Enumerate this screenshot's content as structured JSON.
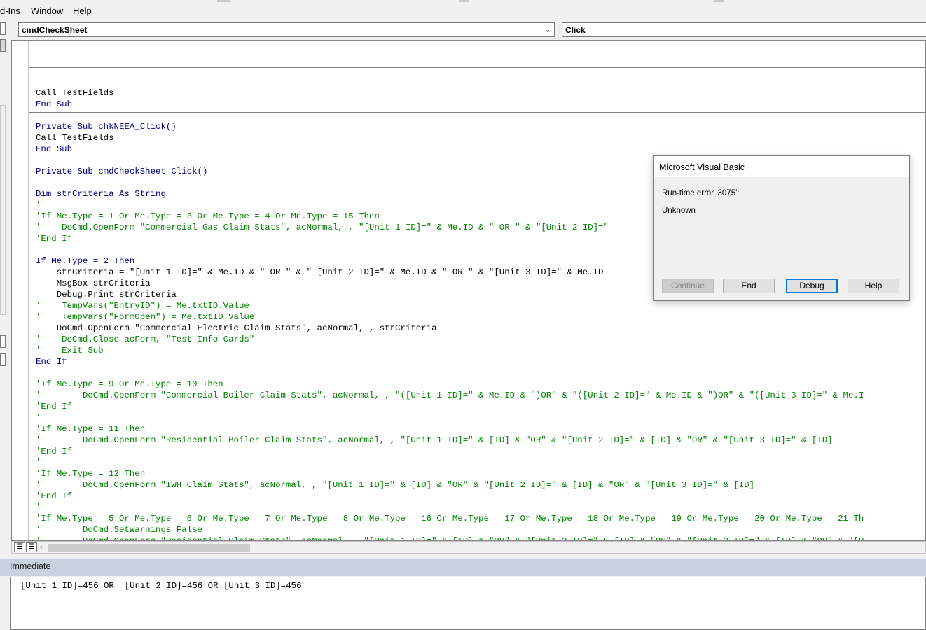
{
  "menubar": {
    "items": [
      "d-Ins",
      "Window",
      "Help"
    ]
  },
  "code_window": {
    "object_combo": "cmdCheckSheet",
    "procedure_combo": "Click",
    "lines": [
      {
        "t": "x",
        "s": "Call TestFields"
      },
      {
        "t": "k",
        "s": "End Sub"
      },
      {
        "t": "x",
        "s": ""
      },
      {
        "t": "k",
        "s": "Private Sub chkNEEA_Click()"
      },
      {
        "t": "x",
        "s": "Call TestFields"
      },
      {
        "t": "k",
        "s": "End Sub"
      },
      {
        "t": "x",
        "s": ""
      },
      {
        "t": "k",
        "s": "Private Sub cmdCheckSheet_Click()"
      },
      {
        "t": "x",
        "s": ""
      },
      {
        "t": "k",
        "s": "Dim strCriteria As String"
      },
      {
        "t": "c",
        "s": "'"
      },
      {
        "t": "c",
        "s": "'If Me.Type = 1 Or Me.Type = 3 Or Me.Type = 4 Or Me.Type = 15 Then"
      },
      {
        "t": "c",
        "s": "'    DoCmd.OpenForm \"Commercial Gas Claim Stats\", acNormal, , \"[Unit 1 ID]=\" & Me.ID & \" OR \" & \"[Unit 2 ID]=\""
      },
      {
        "t": "c",
        "s": "'End If"
      },
      {
        "t": "x",
        "s": ""
      },
      {
        "t": "k",
        "s": "If Me.Type = 2 Then"
      },
      {
        "t": "x",
        "s": "    strCriteria = \"[Unit 1 ID]=\" & Me.ID & \" OR \" & \" [Unit 2 ID]=\" & Me.ID & \" OR \" & \"[Unit 3 ID]=\" & Me.ID"
      },
      {
        "t": "x",
        "s": "    MsgBox strCriteria"
      },
      {
        "t": "x",
        "s": "    Debug.Print strCriteria"
      },
      {
        "t": "c",
        "s": "'    TempVars(\"EntryID\") = Me.txtID.Value"
      },
      {
        "t": "c",
        "s": "'    TempVars(\"FormOpen\") = Me.txtID.Value"
      },
      {
        "t": "x",
        "s": "    DoCmd.OpenForm \"Commercial Electric Claim Stats\", acNormal, , strCriteria"
      },
      {
        "t": "c",
        "s": "'    DoCmd.Close acForm, \"Test Info Cards\""
      },
      {
        "t": "c",
        "s": "'    Exit Sub"
      },
      {
        "t": "k",
        "s": "End If"
      },
      {
        "t": "x",
        "s": ""
      },
      {
        "t": "c",
        "s": "'If Me.Type = 9 Or Me.Type = 10 Then"
      },
      {
        "t": "c",
        "s": "'        DoCmd.OpenForm \"Commercial Boiler Claim Stats\", acNormal, , \"([Unit 1 ID]=\" & Me.ID & \")OR\" & \"([Unit 2 ID]=\" & Me.ID & \")OR\" & \"([Unit 3 ID]=\" & Me.I"
      },
      {
        "t": "c",
        "s": "'End If"
      },
      {
        "t": "c",
        "s": "'"
      },
      {
        "t": "c",
        "s": "'If Me.Type = 11 Then"
      },
      {
        "t": "c",
        "s": "'        DoCmd.OpenForm \"Residential Boiler Claim Stats\", acNormal, , \"[Unit 1 ID]=\" & [ID] & \"OR\" & \"[Unit 2 ID]=\" & [ID] & \"OR\" & \"[Unit 3 ID]=\" & [ID]"
      },
      {
        "t": "c",
        "s": "'End If"
      },
      {
        "t": "c",
        "s": "'"
      },
      {
        "t": "c",
        "s": "'If Me.Type = 12 Then"
      },
      {
        "t": "c",
        "s": "'        DoCmd.OpenForm \"IWH Claim Stats\", acNormal, , \"[Unit 1 ID]=\" & [ID] & \"OR\" & \"[Unit 2 ID]=\" & [ID] & \"OR\" & \"[Unit 3 ID]=\" & [ID]"
      },
      {
        "t": "c",
        "s": "'End If"
      },
      {
        "t": "c",
        "s": "'"
      },
      {
        "t": "c",
        "s": "'If Me.Type = 5 Or Me.Type = 6 Or Me.Type = 7 Or Me.Type = 8 Or Me.Type = 16 Or Me.Type = 17 Or Me.Type = 18 Or Me.Type = 19 Or Me.Type = 20 Or Me.Type = 21 Th"
      },
      {
        "t": "c",
        "s": "'        DoCmd.SetWarnings False"
      },
      {
        "t": "c",
        "s": "'        DoCmd.OpenForm \"Residential Claim Stats\", acNormal, , \"[Unit 1 ID]=\" & [ID] & \"OR\" & \"[Unit 2 ID]=\" & [ID] & \"OR\" & \"[Unit 3 ID]=\" & [ID] & \"OR\" & \"[U"
      },
      {
        "t": "c",
        "s": "'        DoCmd.SetWarnings True"
      },
      {
        "t": "c",
        "s": "'End If"
      },
      {
        "t": "c",
        "s": "'"
      }
    ]
  },
  "immediate": {
    "title": "Immediate",
    "output": "[Unit 1 ID]=456 OR  [Unit 2 ID]=456 OR [Unit 3 ID]=456"
  },
  "dialog": {
    "title": "Microsoft Visual Basic",
    "error": "Run-time error '3075':",
    "detail": "Unknown",
    "buttons": {
      "continue": "Continue",
      "end": "End",
      "debug": "Debug",
      "help": "Help"
    }
  }
}
